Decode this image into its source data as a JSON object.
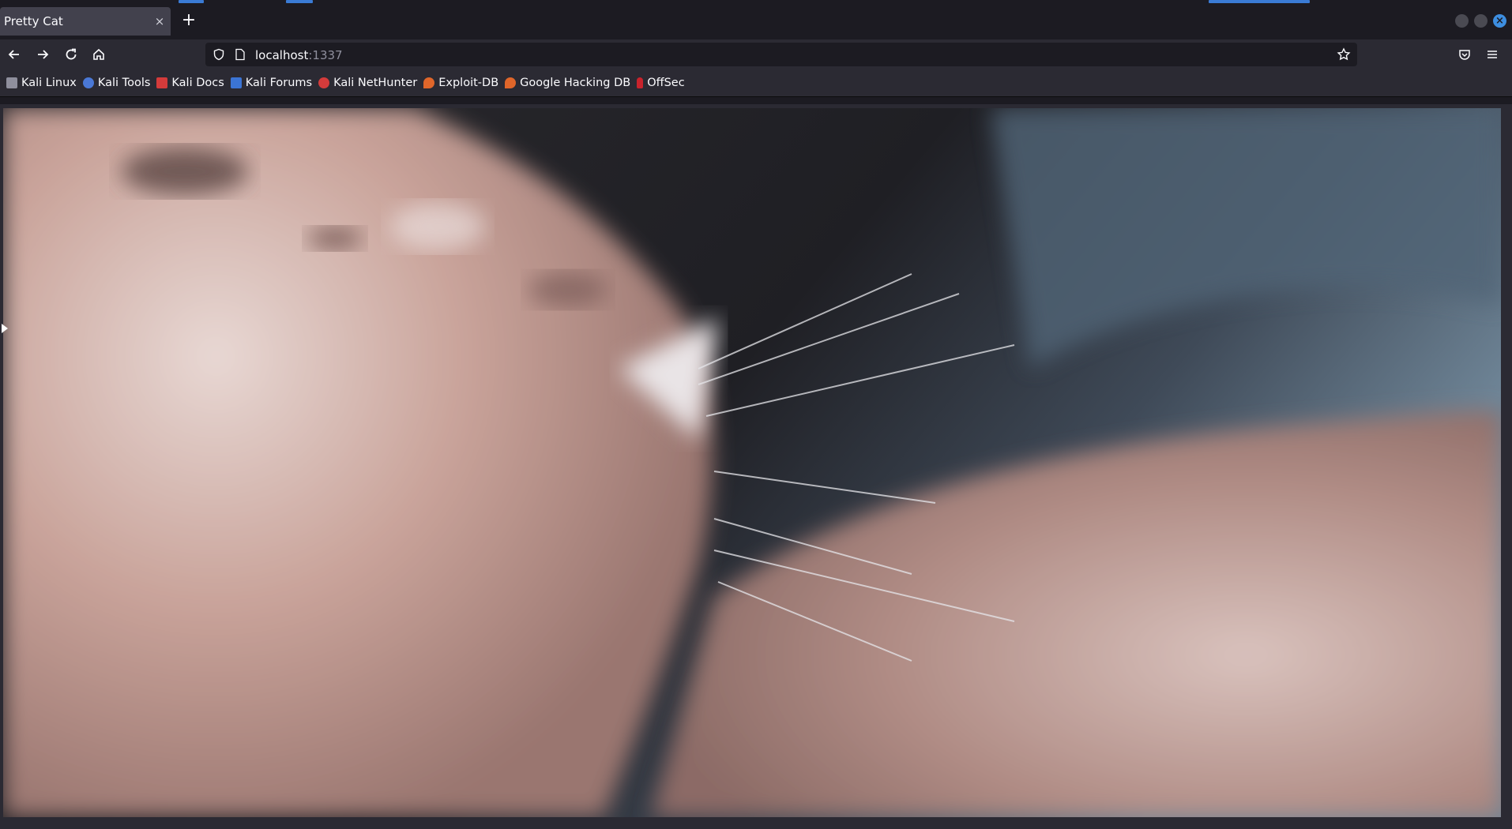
{
  "tab": {
    "title": "Pretty Cat",
    "close_glyph": "×"
  },
  "new_tab_glyph": "+",
  "url": {
    "host": "localhost",
    "port": ":1337"
  },
  "bookmarks": [
    {
      "label": "Kali Linux",
      "icon": "kali-linux-icon",
      "color": "#8f8f9d"
    },
    {
      "label": "Kali Tools",
      "icon": "kali-tools-icon",
      "color": "#4a78d6"
    },
    {
      "label": "Kali Docs",
      "icon": "kali-docs-icon",
      "color": "#d43b3b"
    },
    {
      "label": "Kali Forums",
      "icon": "kali-forums-icon",
      "color": "#3b74d4"
    },
    {
      "label": "Kali NetHunter",
      "icon": "kali-nethunter-icon",
      "color": "#d43b3b"
    },
    {
      "label": "Exploit-DB",
      "icon": "exploit-db-icon",
      "color": "#e0662a"
    },
    {
      "label": "Google Hacking DB",
      "icon": "google-hacking-db-icon",
      "color": "#e0662a"
    },
    {
      "label": "OffSec",
      "icon": "offsec-icon",
      "color": "#c8232c"
    }
  ],
  "colors": {
    "accent": "#3d8ee0",
    "toolbar": "#2b2a33",
    "titlebar": "#1c1b22"
  }
}
